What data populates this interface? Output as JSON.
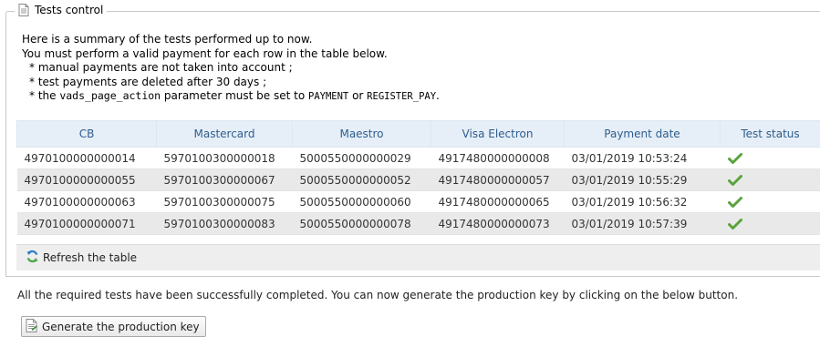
{
  "section": {
    "title": "Tests control"
  },
  "intro": {
    "line1": "Here is a summary of the tests performed up to now.",
    "line2": "You must perform a valid payment for each row in the table below.",
    "bullet1": "* manual payments are not taken into account ;",
    "bullet2": "* test payments are deleted after 30 days ;",
    "bullet3_prefix": "* the ",
    "bullet3_param": "vads_page_action",
    "bullet3_mid": " parameter must be set to ",
    "bullet3_value1": "PAYMENT",
    "bullet3_or": " or ",
    "bullet3_value2": "REGISTER_PAY",
    "bullet3_end": "."
  },
  "table": {
    "headers": [
      "CB",
      "Mastercard",
      "Maestro",
      "Visa Electron",
      "Payment date",
      "Test status"
    ],
    "rows": [
      [
        "4970100000000014",
        "5970100300000018",
        "5000550000000029",
        "4917480000000008",
        "03/01/2019 10:53:24",
        "check-icon"
      ],
      [
        "4970100000000055",
        "5970100300000067",
        "5000550000000052",
        "4917480000000057",
        "03/01/2019 10:55:29",
        "check-icon"
      ],
      [
        "4970100000000063",
        "5970100300000075",
        "5000550000000060",
        "4917480000000065",
        "03/01/2019 10:56:32",
        "check-icon"
      ],
      [
        "4970100000000071",
        "5970100300000083",
        "5000550000000078",
        "4917480000000073",
        "03/01/2019 10:57:39",
        "check-icon"
      ]
    ]
  },
  "refresh": {
    "label": "Refresh the table",
    "icon": "refresh-icon"
  },
  "completion_message": "All the required tests have been successfully completed. You can now generate the production key by clicking on the below button.",
  "generate_button": {
    "label": "Generate the production key",
    "icon": "document-icon"
  },
  "colors": {
    "header_bg": "#e6eef7",
    "header_text": "#2d5e8e",
    "row_alt_bg": "#e9e9e9",
    "check_green": "#5aa33c"
  }
}
